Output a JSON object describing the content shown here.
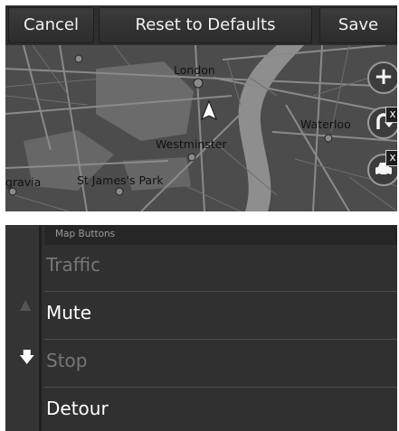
{
  "toolbar": {
    "cancel_label": "Cancel",
    "reset_label": "Reset to Defaults",
    "save_label": "Save"
  },
  "map": {
    "place_labels": {
      "london": "London",
      "westminster": "Westminster",
      "waterloo": "Waterloo",
      "st_james": "St James's Park",
      "gravia": "gravia"
    },
    "controls": {
      "zoom_symbol": "+",
      "detour_badge": "x",
      "traffic_badge": "x"
    }
  },
  "list": {
    "header": "Map Buttons",
    "items": [
      {
        "label": "Traffic",
        "state": "dimmed"
      },
      {
        "label": "Mute",
        "state": "enabled"
      },
      {
        "label": "Stop",
        "state": "dimmed"
      },
      {
        "label": "Detour",
        "state": "enabled"
      }
    ]
  },
  "colors": {
    "map_background": "#4a4a4a",
    "park": "#6a6a6a",
    "river": "#8c8c8c",
    "list_background": "#303030",
    "text_enabled": "#ffffff",
    "text_dimmed": "#777777"
  }
}
